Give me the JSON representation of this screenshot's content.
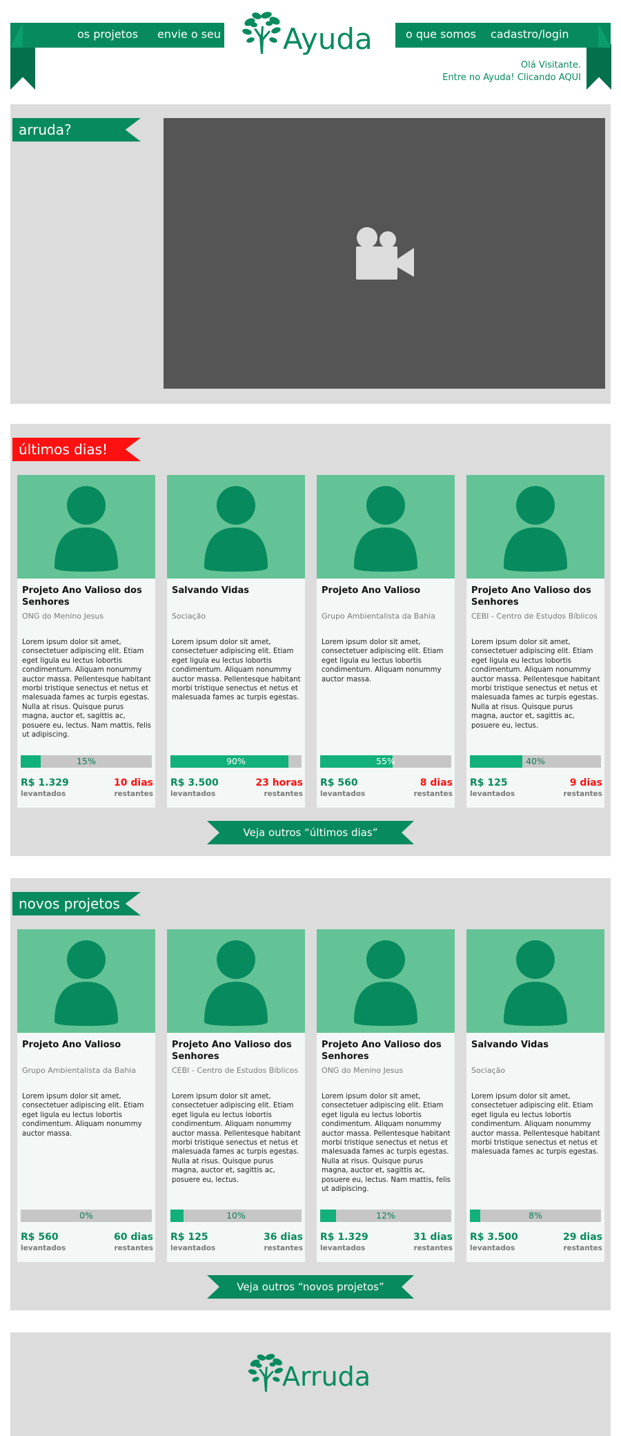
{
  "header": {
    "nav_left": [
      "os projetos",
      "envie o seu"
    ],
    "nav_right": [
      "o que somos",
      "cadastro/login"
    ],
    "logo_text": "Ayuda",
    "greeting_line1": "Olá Visitante.",
    "greeting_line2": "Entre no Ayuda! Clicando AQUI"
  },
  "intro": {
    "flag": "arruda?"
  },
  "ultimos": {
    "flag": "últimos dias!",
    "more_button": "Veja outros “últimos dias”",
    "cards": [
      {
        "title": "Projeto Ano Valioso dos Senhores",
        "org": "ONG do Menino Jesus",
        "desc": "Lorem ipsum dolor sit amet, consectetuer adipiscing elit. Etiam eget ligula eu lectus lobortis condimentum. Aliquam nonummy auctor massa. Pellentesque habitant morbi tristique senectus et netus et malesuada fames ac turpis egestas. Nulla at risus. Quisque purus magna, auctor et, sagittis ac, posuere eu, lectus. Nam mattis, felis ut adipiscing.",
        "progress": 0.15,
        "progress_label": "15%",
        "amount": "R$ 1.329",
        "amount_label": "levantados",
        "remaining": "10 dias",
        "remaining_label": "restantes"
      },
      {
        "title": "Salvando Vidas",
        "org": "Sociação",
        "desc": "Lorem ipsum dolor sit amet, consectetuer adipiscing elit. Etiam eget ligula eu lectus lobortis condimentum. Aliquam nonummy auctor massa. Pellentesque habitant morbi tristique senectus et netus et malesuada fames ac turpis egestas.",
        "progress": 0.9,
        "progress_label": "90%",
        "amount": "R$ 3.500",
        "amount_label": "levantados",
        "remaining": "23 horas",
        "remaining_label": "restantes"
      },
      {
        "title": "Projeto Ano Valioso",
        "org": "Grupo Ambientalista da Bahia",
        "desc": "Lorem ipsum dolor sit amet, consectetuer adipiscing elit. Etiam eget ligula eu lectus lobortis condimentum. Aliquam nonummy auctor massa.",
        "progress": 0.55,
        "progress_label": "55%",
        "amount": "R$ 560",
        "amount_label": "levantados",
        "remaining": "8 dias",
        "remaining_label": "restantes"
      },
      {
        "title": "Projeto Ano Valioso dos Senhores",
        "org": "CEBI - Centro de Estudos Bíblicos",
        "desc": "Lorem ipsum dolor sit amet, consectetuer adipiscing elit. Etiam eget ligula eu lectus lobortis condimentum. Aliquam nonummy auctor massa. Pellentesque habitant morbi tristique senectus et netus et malesuada fames ac turpis egestas. Nulla at risus. Quisque purus magna, auctor et, sagittis ac, posuere eu, lectus.",
        "progress": 0.4,
        "progress_label": "40%",
        "amount": "R$ 125",
        "amount_label": "levantados",
        "remaining": "9 dias",
        "remaining_label": "restantes"
      }
    ]
  },
  "novos": {
    "flag": "novos projetos",
    "more_button": "Veja outros “novos projetos”",
    "cards": [
      {
        "title": "Projeto Ano Valioso",
        "org": "Grupo Ambientalista da Bahia",
        "desc": "Lorem ipsum dolor sit amet, consectetuer adipiscing elit. Etiam eget ligula eu lectus lobortis condimentum. Aliquam nonummy auctor massa.",
        "progress": 0.0,
        "progress_label": "0%",
        "amount": "R$ 560",
        "amount_label": "levantados",
        "remaining": "60 dias",
        "remaining_label": "restantes"
      },
      {
        "title": "Projeto Ano Valioso dos Senhores",
        "org": "CEBI - Centro de Estudos Bíblicos",
        "desc": "Lorem ipsum dolor sit amet, consectetuer adipiscing elit. Etiam eget ligula eu lectus lobortis condimentum. Aliquam nonummy auctor massa. Pellentesque habitant morbi tristique senectus et netus et malesuada fames ac turpis egestas. Nulla at risus. Quisque purus magna, auctor et, sagittis ac, posuere eu, lectus.",
        "progress": 0.1,
        "progress_label": "10%",
        "amount": "R$ 125",
        "amount_label": "levantados",
        "remaining": "36 dias",
        "remaining_label": "restantes"
      },
      {
        "title": "Projeto Ano Valioso dos Senhores",
        "org": "ONG do Menino Jesus",
        "desc": "Lorem ipsum dolor sit amet, consectetuer adipiscing elit. Etiam eget ligula eu lectus lobortis condimentum. Aliquam nonummy auctor massa. Pellentesque habitant morbi tristique senectus et netus et malesuada fames ac turpis egestas. Nulla at risus. Quisque purus magna, auctor et, sagittis ac, posuere eu, lectus. Nam mattis, felis ut adipiscing.",
        "progress": 0.12,
        "progress_label": "12%",
        "amount": "R$ 1.329",
        "amount_label": "levantados",
        "remaining": "31 dias",
        "remaining_label": "restantes"
      },
      {
        "title": "Salvando Vidas",
        "org": "Sociação",
        "desc": "Lorem ipsum dolor sit amet, consectetuer adipiscing elit. Etiam eget ligula eu lectus lobortis condimentum. Aliquam nonummy auctor massa. Pellentesque habitant morbi tristique senectus et netus et malesuada fames ac turpis egestas.",
        "progress": 0.08,
        "progress_label": "8%",
        "amount": "R$ 3.500",
        "amount_label": "levantados",
        "remaining": "29 dias",
        "remaining_label": "restantes"
      }
    ]
  },
  "footer": {
    "logo_text": "Arruda"
  },
  "colors": {
    "brand_green": "#078a5e",
    "card_image_green": "#64c396",
    "progress_green": "#12b07a",
    "urgent_red": "#ff1111",
    "section_gray": "#dcdcdc",
    "video_gray": "#555555"
  },
  "icons": {
    "logo": "tree-logo-icon",
    "video": "video-camera-icon",
    "avatar": "user-avatar-icon"
  }
}
